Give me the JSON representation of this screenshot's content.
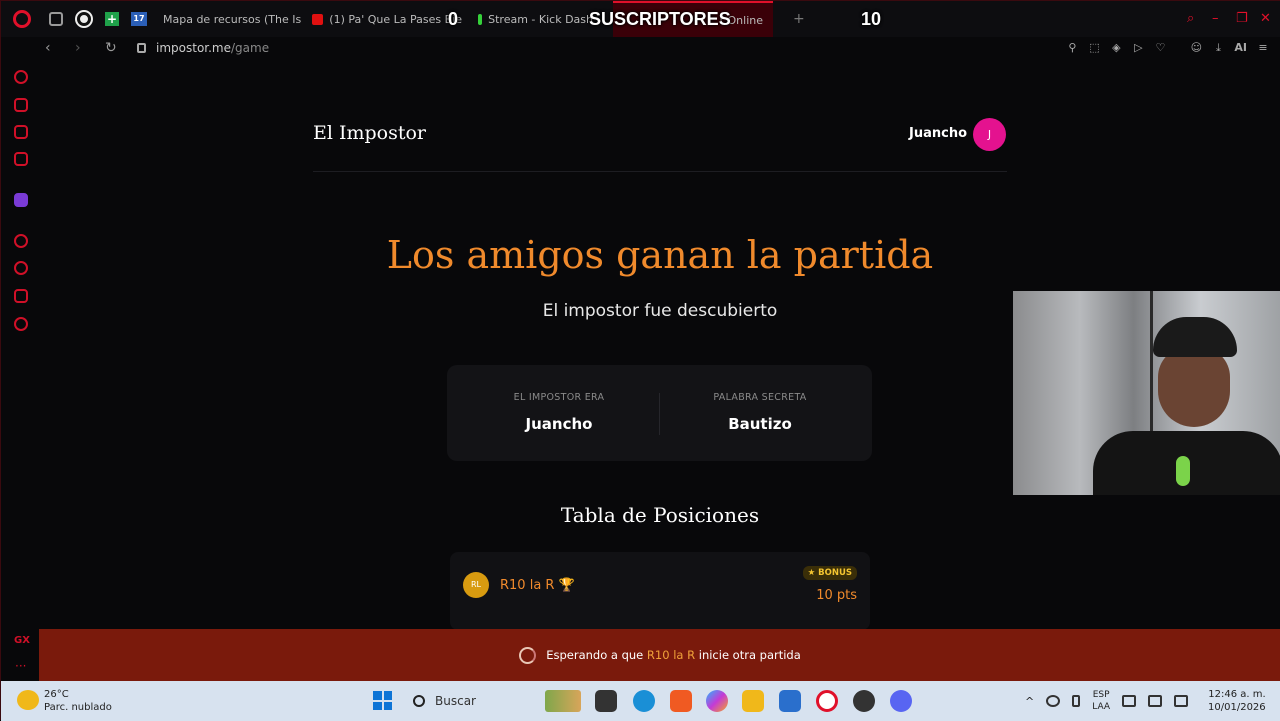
{
  "browser": {
    "tabs": [
      {
        "label": "Mapa de recursos (The Isl"
      },
      {
        "label": "(1) Pa' Que La Pases Bie"
      },
      {
        "label": "Stream - Kick Dash"
      },
      {
        "label": "r Online"
      }
    ],
    "overlay": {
      "left_count": "0",
      "title": "SUSCRIPTORES",
      "right_count": "10"
    },
    "url_host": "impostor.me",
    "url_path": "/game",
    "ai_label": "AI"
  },
  "site": {
    "title": "El Impostor",
    "user_name": "Juancho",
    "user_initial": "J"
  },
  "result": {
    "headline": "Los amigos ganan la partida",
    "subline": "El impostor fue descubierto",
    "impostor_label": "EL IMPOSTOR ERA",
    "impostor_value": "Juancho",
    "word_label": "PALABRA SECRETA",
    "word_value": "Bautizo"
  },
  "leaderboard": {
    "title": "Tabla de Posiciones",
    "rows": [
      {
        "initials": "RL",
        "name": "R10 la R 🏆",
        "badge": "★ BONUS",
        "points": "10 pts"
      }
    ]
  },
  "status": {
    "prefix": "Esperando a que ",
    "player": "R10 la R",
    "suffix": " inicie otra partida"
  },
  "sidebar_bottom": {
    "gx": "GX",
    "more": "···"
  },
  "taskbar": {
    "temp": "26°C",
    "weather": "Parc. nublado",
    "search_placeholder": "Buscar",
    "lang_1": "ESP",
    "lang_2": "LAA",
    "time": "12:46 a. m.",
    "date": "10/01/2026"
  },
  "colors": {
    "accent": "#f08a2c",
    "brand": "#e0102a",
    "status_bg": "#7a1a0c",
    "avatar": "#e4128f"
  }
}
